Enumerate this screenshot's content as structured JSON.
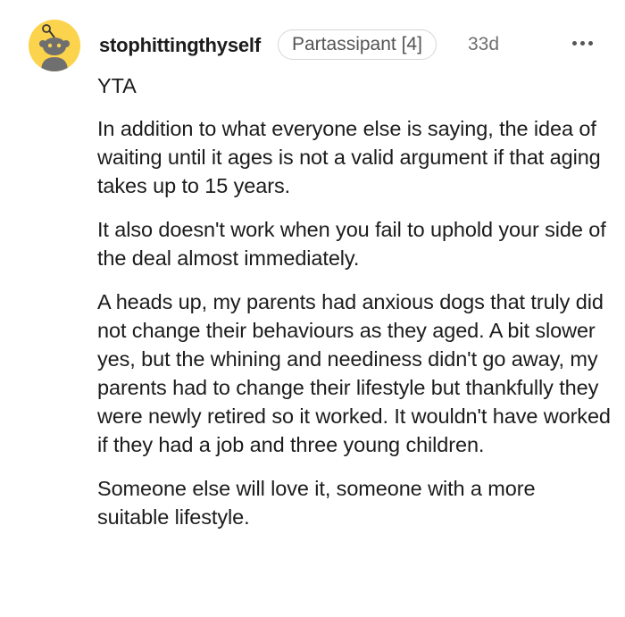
{
  "comment": {
    "author": "stophittingthyself",
    "flair": "Partassipant [4]",
    "age": "33d",
    "avatar_icon": "reddit-snoo-avatar-icon",
    "more_icon": "more-options-icon",
    "paragraphs": [
      "YTA",
      "In addition to what everyone else is saying, the idea of waiting until it ages is not a valid argument if that aging takes up to 15 years.",
      "It also doesn't work when you fail to uphold your side of the deal almost immediately.",
      "A heads up, my parents had anxious dogs that truly did not change their behaviours as they aged. A bit slower yes, but the whining and neediness didn't go away, my parents had to change their lifestyle but thankfully they were newly retired so it worked. It wouldn't have worked if they had a job and three young children.",
      "Someone else will love it, someone with a more suitable lifestyle."
    ]
  },
  "colors": {
    "avatar_background": "#fcd34d",
    "text": "#1c1c1c",
    "muted": "#6e6e6e",
    "flair_border": "#d6d6d6"
  }
}
